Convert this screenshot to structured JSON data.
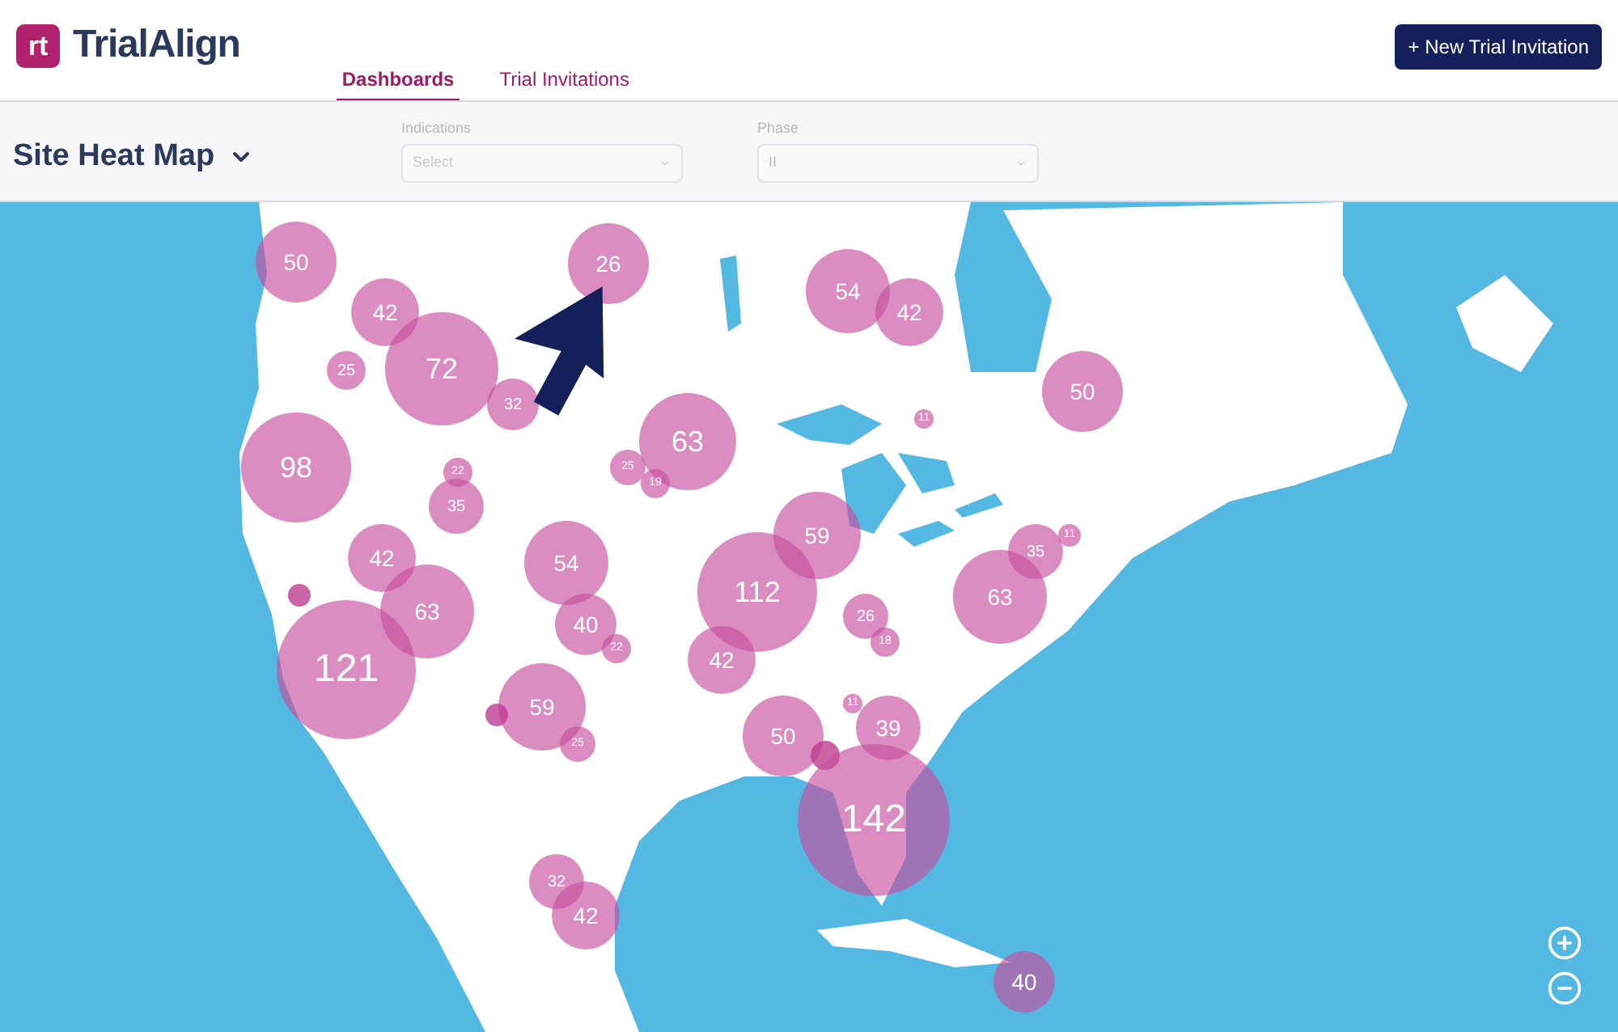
{
  "app": {
    "logo_mark": "rt",
    "name": "TrialAlign"
  },
  "tabs": [
    {
      "label": "Dashboards",
      "selected": true
    },
    {
      "label": "Trial Invitations",
      "selected": false
    }
  ],
  "new_button": "+ New Trial Invitation",
  "view": {
    "title": "Site Heat Map"
  },
  "filters": [
    {
      "label": "Indications",
      "placeholder": "Select"
    },
    {
      "label": "Phase",
      "value": "II"
    }
  ],
  "map": {
    "bubbles": [
      {
        "count": "50"
      },
      {
        "count": "42"
      },
      {
        "count": "72"
      },
      {
        "count": "25"
      },
      {
        "count": "32"
      },
      {
        "count": "26"
      },
      {
        "count": "98"
      },
      {
        "count": "22"
      },
      {
        "count": "35"
      },
      {
        "count": "63"
      },
      {
        "count": "25"
      },
      {
        "count": "19"
      },
      {
        "count": "54"
      },
      {
        "count": "42"
      },
      {
        "count": "50"
      },
      {
        "count": "11"
      },
      {
        "count": "42"
      },
      {
        "count": "63"
      },
      {
        "kind": "unlabeled"
      },
      {
        "count": "121"
      },
      {
        "count": "54"
      },
      {
        "count": "40"
      },
      {
        "count": "22"
      },
      {
        "count": "59"
      },
      {
        "kind": "unlabeled"
      },
      {
        "count": "25"
      },
      {
        "count": "59"
      },
      {
        "count": "112"
      },
      {
        "count": "42"
      },
      {
        "count": "26"
      },
      {
        "count": "18"
      },
      {
        "count": "63"
      },
      {
        "count": "35"
      },
      {
        "count": "11"
      },
      {
        "count": "11"
      },
      {
        "count": "50"
      },
      {
        "count": "39"
      },
      {
        "kind": "unlabeled"
      },
      {
        "count": "142"
      },
      {
        "count": "32"
      },
      {
        "count": "42"
      },
      {
        "count": "40"
      }
    ]
  }
}
